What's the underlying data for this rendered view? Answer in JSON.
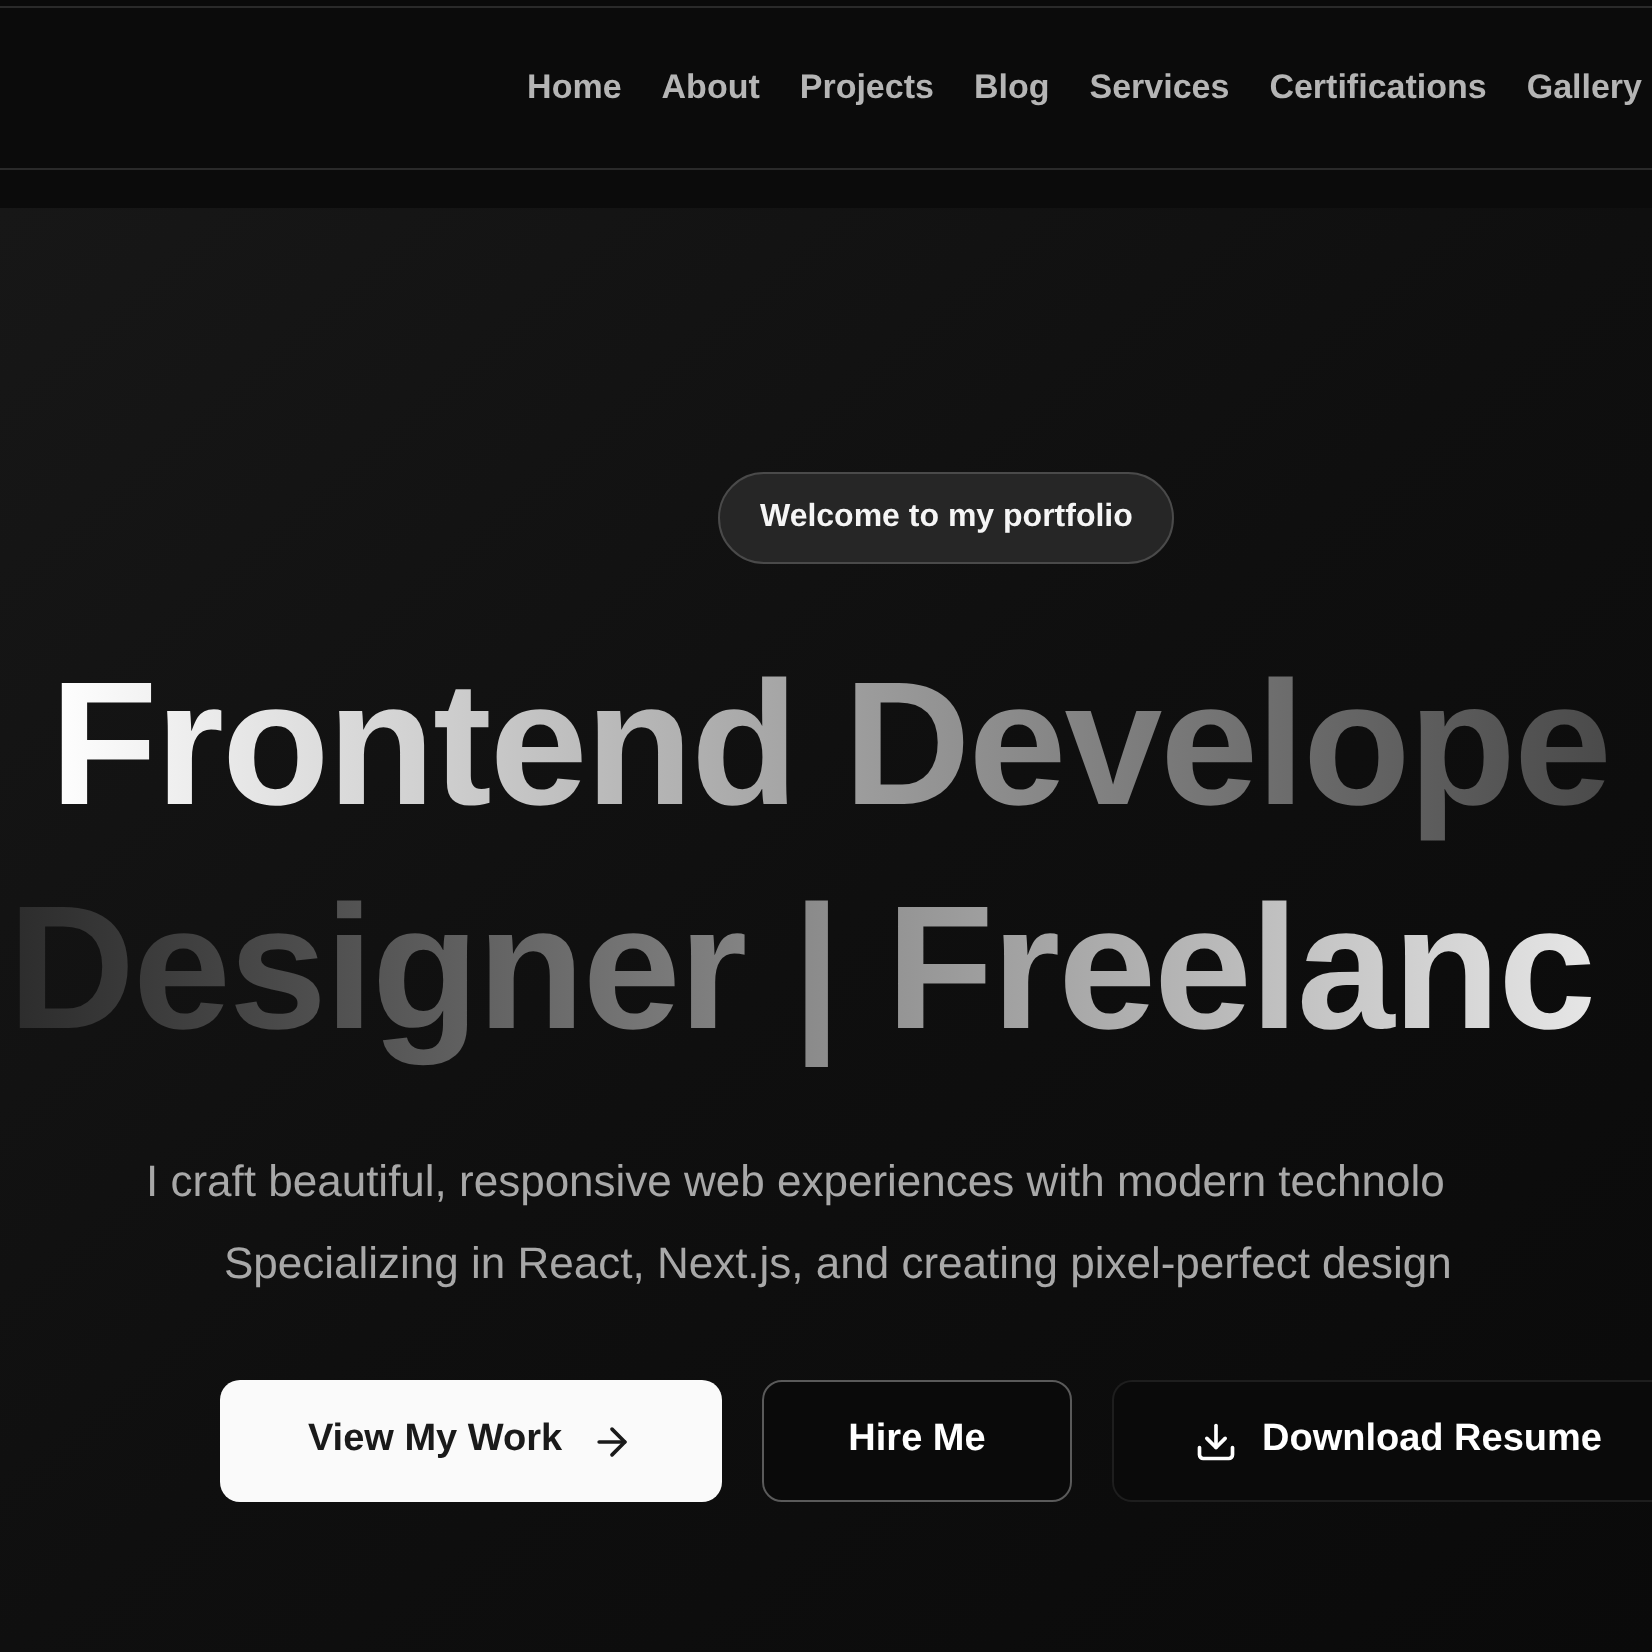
{
  "nav": {
    "items": [
      "Home",
      "About",
      "Projects",
      "Blog",
      "Services",
      "Certifications",
      "Gallery"
    ]
  },
  "hero": {
    "badge": "Welcome to my portfolio",
    "heading_lines": [
      "Frontend Develope",
      "Designer | Freelanc"
    ],
    "subtitle_lines": [
      "I craft beautiful, responsive web experiences with modern technolo",
      "Specializing in React, Next.js, and creating pixel-perfect design"
    ],
    "buttons": [
      {
        "label": "View My Work",
        "kind": "primary"
      },
      {
        "label": "Hire Me",
        "kind": "outline"
      },
      {
        "label": "Download Resume",
        "kind": "ghost"
      }
    ]
  }
}
